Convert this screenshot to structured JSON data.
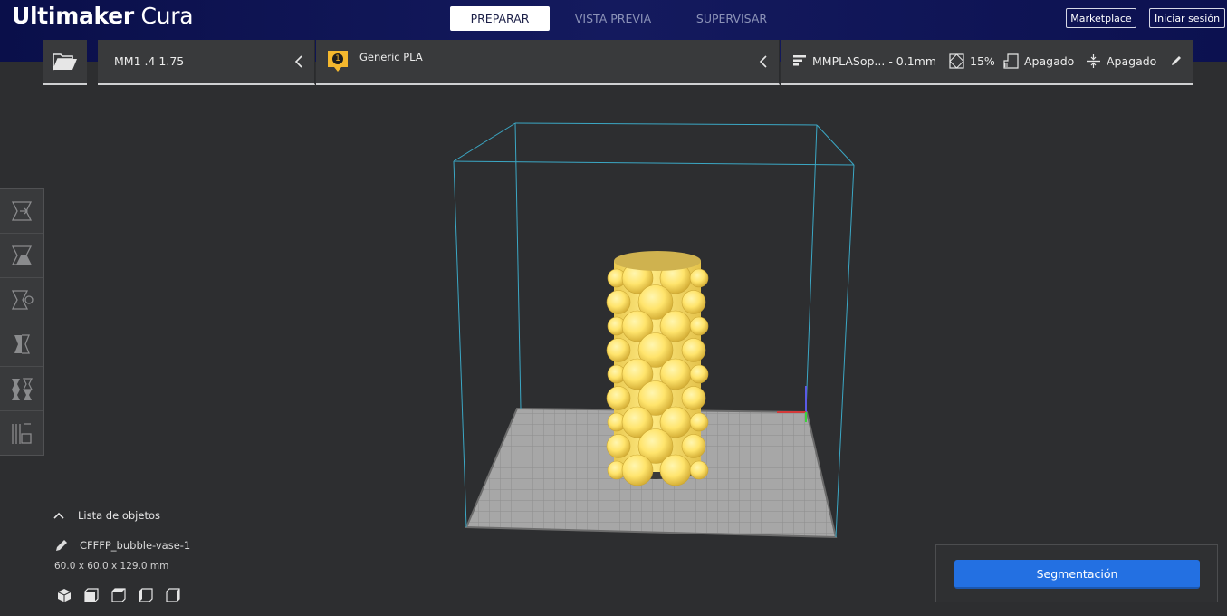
{
  "app": {
    "title_bold": "Ultimaker",
    "title_light": "Cura"
  },
  "stages": {
    "prepare": "PREPARAR",
    "preview": "VISTA PREVIA",
    "monitor": "SUPERVISAR",
    "active": "prepare"
  },
  "header_buttons": {
    "marketplace": "Marketplace",
    "signin": "Iniciar sesión"
  },
  "printer": {
    "name": "MM1 .4 1.75"
  },
  "material": {
    "extruder_number": "1",
    "name": "Generic PLA",
    "badge_color": "#f5b82e"
  },
  "print_settings": {
    "profile": "MMPLASop... - 0.1mm",
    "infill": "15%",
    "support": "Apagado",
    "adhesion": "Apagado"
  },
  "object_list": {
    "header": "Lista de objetos",
    "object_name": "CFFFP_bubble-vase-1",
    "dimensions": "60.0 x 60.0 x 129.0 mm"
  },
  "slice": {
    "button_label": "Segmentación",
    "accent": "#2370e2"
  },
  "tools": [
    "move-tool-icon",
    "scale-tool-icon",
    "rotate-tool-icon",
    "mirror-tool-icon",
    "per-model-settings-icon",
    "support-blocker-icon"
  ],
  "colors": {
    "model": "#ffe26a",
    "build_volume": "#3ba7c4",
    "build_plate": "#9e9e9e"
  }
}
